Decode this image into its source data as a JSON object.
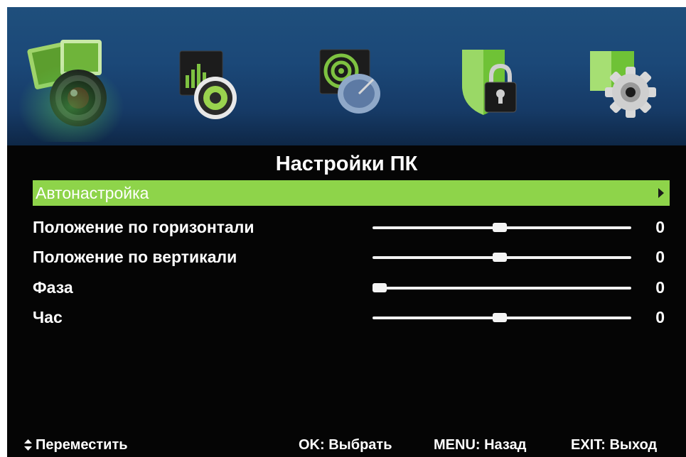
{
  "menu": {
    "title": "Настройки ПК",
    "icons": [
      "picture-icon",
      "sound-icon",
      "channel-icon",
      "lock-icon",
      "setup-icon"
    ],
    "items": [
      {
        "label": "Автонастройка",
        "selected": true,
        "type": "submenu"
      },
      {
        "label": "Положение по горизонтали",
        "type": "slider",
        "value": "0",
        "level": 0.5
      },
      {
        "label": "Положение по вертикали",
        "type": "slider",
        "value": "0",
        "level": 0.5
      },
      {
        "label": "Фаза",
        "type": "slider",
        "value": "0",
        "level": 0.0
      },
      {
        "label": "Час",
        "type": "slider",
        "value": "0",
        "level": 0.5
      }
    ]
  },
  "footer": {
    "move": "Переместить",
    "ok": "OK: Выбрать",
    "menu": "MENU: Назад",
    "exit": "EXIT: Выход"
  },
  "colors": {
    "highlight": "#8ed44a",
    "background": "#050505",
    "icon_bar": "#1b4878"
  }
}
